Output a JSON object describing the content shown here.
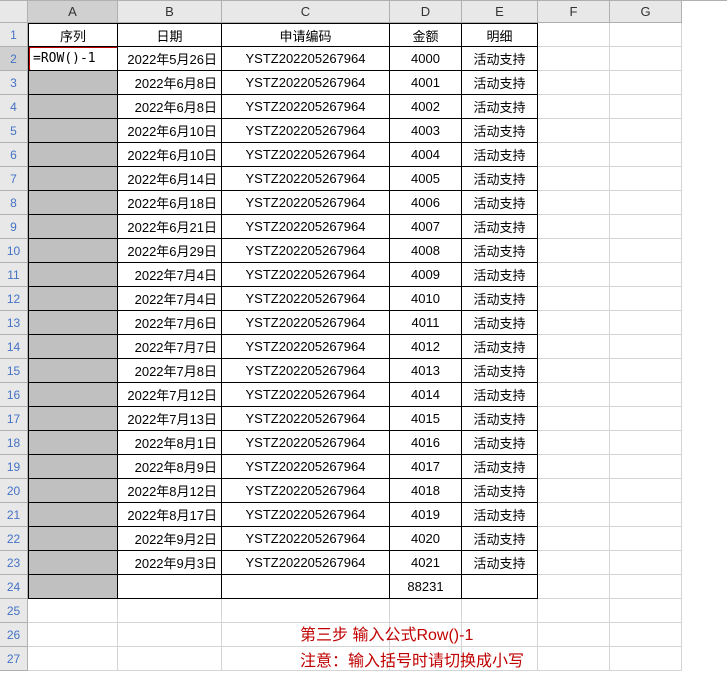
{
  "columns": [
    "A",
    "B",
    "C",
    "D",
    "E",
    "F",
    "G"
  ],
  "col_widths": {
    "A": 90,
    "B": 104,
    "C": 168,
    "D": 72,
    "E": 76,
    "F": 72,
    "G": 72
  },
  "headers": {
    "A": "序列",
    "B": "日期",
    "C": "申请编码",
    "D": "金额",
    "E": "明细"
  },
  "active_cell": {
    "row": 2,
    "col": "A",
    "formula": "=ROW()-1"
  },
  "rows": [
    {
      "r": 2,
      "A": "=ROW()-1",
      "B": "2022年5月26日",
      "C": "YSTZ202205267964",
      "D": "4000",
      "E": "活动支持"
    },
    {
      "r": 3,
      "A": "",
      "B": "2022年6月8日",
      "C": "YSTZ202205267964",
      "D": "4001",
      "E": "活动支持"
    },
    {
      "r": 4,
      "A": "",
      "B": "2022年6月8日",
      "C": "YSTZ202205267964",
      "D": "4002",
      "E": "活动支持"
    },
    {
      "r": 5,
      "A": "",
      "B": "2022年6月10日",
      "C": "YSTZ202205267964",
      "D": "4003",
      "E": "活动支持"
    },
    {
      "r": 6,
      "A": "",
      "B": "2022年6月10日",
      "C": "YSTZ202205267964",
      "D": "4004",
      "E": "活动支持"
    },
    {
      "r": 7,
      "A": "",
      "B": "2022年6月14日",
      "C": "YSTZ202205267964",
      "D": "4005",
      "E": "活动支持"
    },
    {
      "r": 8,
      "A": "",
      "B": "2022年6月18日",
      "C": "YSTZ202205267964",
      "D": "4006",
      "E": "活动支持"
    },
    {
      "r": 9,
      "A": "",
      "B": "2022年6月21日",
      "C": "YSTZ202205267964",
      "D": "4007",
      "E": "活动支持"
    },
    {
      "r": 10,
      "A": "",
      "B": "2022年6月29日",
      "C": "YSTZ202205267964",
      "D": "4008",
      "E": "活动支持"
    },
    {
      "r": 11,
      "A": "",
      "B": "2022年7月4日",
      "C": "YSTZ202205267964",
      "D": "4009",
      "E": "活动支持"
    },
    {
      "r": 12,
      "A": "",
      "B": "2022年7月4日",
      "C": "YSTZ202205267964",
      "D": "4010",
      "E": "活动支持"
    },
    {
      "r": 13,
      "A": "",
      "B": "2022年7月6日",
      "C": "YSTZ202205267964",
      "D": "4011",
      "E": "活动支持"
    },
    {
      "r": 14,
      "A": "",
      "B": "2022年7月7日",
      "C": "YSTZ202205267964",
      "D": "4012",
      "E": "活动支持"
    },
    {
      "r": 15,
      "A": "",
      "B": "2022年7月8日",
      "C": "YSTZ202205267964",
      "D": "4013",
      "E": "活动支持"
    },
    {
      "r": 16,
      "A": "",
      "B": "2022年7月12日",
      "C": "YSTZ202205267964",
      "D": "4014",
      "E": "活动支持"
    },
    {
      "r": 17,
      "A": "",
      "B": "2022年7月13日",
      "C": "YSTZ202205267964",
      "D": "4015",
      "E": "活动支持"
    },
    {
      "r": 18,
      "A": "",
      "B": "2022年8月1日",
      "C": "YSTZ202205267964",
      "D": "4016",
      "E": "活动支持"
    },
    {
      "r": 19,
      "A": "",
      "B": "2022年8月9日",
      "C": "YSTZ202205267964",
      "D": "4017",
      "E": "活动支持"
    },
    {
      "r": 20,
      "A": "",
      "B": "2022年8月12日",
      "C": "YSTZ202205267964",
      "D": "4018",
      "E": "活动支持"
    },
    {
      "r": 21,
      "A": "",
      "B": "2022年8月17日",
      "C": "YSTZ202205267964",
      "D": "4019",
      "E": "活动支持"
    },
    {
      "r": 22,
      "A": "",
      "B": "2022年9月2日",
      "C": "YSTZ202205267964",
      "D": "4020",
      "E": "活动支持"
    },
    {
      "r": 23,
      "A": "",
      "B": "2022年9月3日",
      "C": "YSTZ202205267964",
      "D": "4021",
      "E": "活动支持"
    },
    {
      "r": 24,
      "A": "",
      "B": "",
      "C": "",
      "D": "88231",
      "E": ""
    }
  ],
  "empty_rows": [
    25,
    26,
    27
  ],
  "annotation": {
    "line1": "第三步  输入公式Row()-1",
    "line2": "注意：输入括号时请切换成小写"
  }
}
